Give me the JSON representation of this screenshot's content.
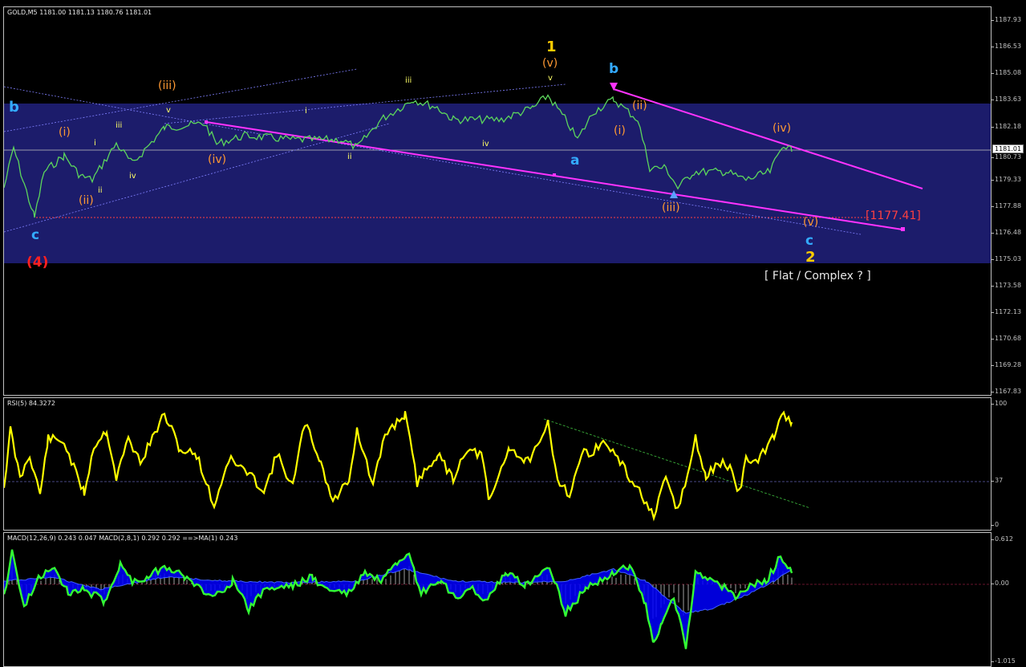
{
  "main": {
    "symbol_header": "GOLD,M5  1181.00 1181.13 1180.76 1181.01",
    "price_scale": [
      "1187.93",
      "1186.53",
      "1185.08",
      "1183.63",
      "1182.18",
      "1180.73",
      "1179.33",
      "1177.88",
      "1176.48",
      "1175.03",
      "1173.58",
      "1172.13",
      "1170.68",
      "1169.28",
      "1167.83"
    ],
    "current_price": "1181.01",
    "target_level": "[1177.41]",
    "wave_labels": {
      "b_left": "b",
      "c_left": "c",
      "four": "(4)",
      "i_paren_1": "(i)",
      "ii_paren_1": "(ii)",
      "iii_paren_1": "(iii)",
      "iv_paren_1": "(iv)",
      "i_small": "i",
      "ii_small": "ii",
      "iii_small": "iii",
      "iv_small": "iv",
      "v_small": "v",
      "i_small_2": "i",
      "ii_small_2": "ii",
      "iii_small_2": "iii",
      "iv_small_2": "iv",
      "v_small_2": "v",
      "one": "1",
      "v_paren_top": "(v)",
      "a_label": "a",
      "b_right": "b",
      "i_paren_2": "(i)",
      "ii_paren_2": "(ii)",
      "iii_paren_2": "(iii)",
      "iv_paren_2": "(iv)",
      "v_paren_2": "(v)",
      "c_right": "c",
      "two": "2",
      "flat_note": "[ Flat / Complex ? ]"
    }
  },
  "rsi": {
    "header": "RSI(5) 84.3272",
    "scale": [
      "100",
      "37",
      "0"
    ]
  },
  "macd": {
    "header": "MACD(12,26,9) 0.243 0.047  MACD(2,8,1) 0.292 0.292  ==>MA(1) 0.243",
    "scale": [
      "0.612",
      "0.00",
      "-1.015"
    ]
  },
  "colors": {
    "background": "#000000",
    "zone": "#1c1c6b",
    "trendline": "#ff33ff",
    "price_line": "#5cd65c",
    "rsi_line": "#ffff00",
    "macd_line": "#33ff33",
    "macd_fill": "#0000ff",
    "wave_orange": "#ff9933",
    "wave_blue": "#33aaff",
    "wave_yellow": "#ffcc00",
    "wave_red": "#ff2020"
  }
}
